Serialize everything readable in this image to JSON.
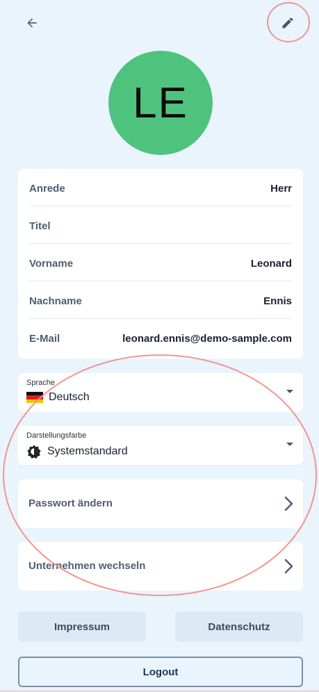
{
  "avatar": {
    "initials": "LE"
  },
  "profile": [
    {
      "label": "Anrede",
      "value": "Herr"
    },
    {
      "label": "Titel",
      "value": ""
    },
    {
      "label": "Vorname",
      "value": "Leonard"
    },
    {
      "label": "Nachname",
      "value": "Ennis"
    },
    {
      "label": "E-Mail",
      "value": "leonard.ennis@demo-sample.com"
    }
  ],
  "language": {
    "label": "Sprache",
    "value": "Deutsch"
  },
  "appearance": {
    "label": "Darstellungsfarbe",
    "value": "Systemstandard"
  },
  "actions": {
    "change_password": "Passwort ändern",
    "switch_company": "Unternehmen wechseln"
  },
  "footer": {
    "imprint": "Impressum",
    "privacy": "Datenschutz",
    "logout": "Logout"
  },
  "icons": {
    "back": "arrow-left-icon",
    "edit": "pencil-icon",
    "language_flag": "german-flag-icon",
    "appearance": "brightness-icon",
    "dropdown": "caret-down-icon",
    "nav": "chevron-right-icon"
  },
  "colors": {
    "background": "#eaf4fd",
    "avatar": "#4ec37e",
    "annotation": "#f2958d"
  }
}
